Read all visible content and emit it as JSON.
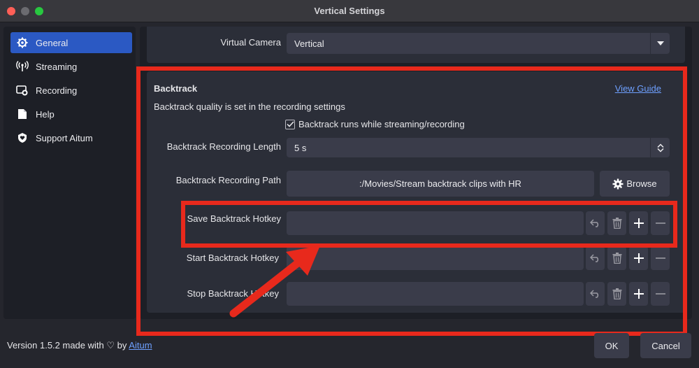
{
  "window": {
    "title": "Vertical Settings"
  },
  "sidebar": {
    "items": [
      {
        "label": "General",
        "icon": "gear-icon",
        "active": true
      },
      {
        "label": "Streaming",
        "icon": "antenna-icon"
      },
      {
        "label": "Recording",
        "icon": "record-icon"
      },
      {
        "label": "Help",
        "icon": "document-icon"
      },
      {
        "label": "Support Aitum",
        "icon": "heart-shield-icon"
      }
    ]
  },
  "general": {
    "virtual_camera_label": "Virtual Camera",
    "virtual_camera_value": "Vertical"
  },
  "backtrack": {
    "title": "Backtrack",
    "guide_link": "View Guide",
    "note": "Backtrack quality is set in the recording settings",
    "checkbox_label": "Backtrack runs while streaming/recording",
    "checkbox_checked": true,
    "length_label": "Backtrack Recording Length",
    "length_value": "5 s",
    "path_label": "Backtrack Recording Path",
    "path_value": ":/Movies/Stream backtrack clips with HR",
    "browse_label": "Browse",
    "hotkeys": [
      {
        "label": "Save Backtrack Hotkey",
        "value": ""
      },
      {
        "label": "Start Backtrack Hotkey",
        "value": ""
      },
      {
        "label": "Stop Backtrack Hotkey",
        "value": ""
      }
    ]
  },
  "footer": {
    "version_text": "Version 1.5.2 made with",
    "heart": "♡",
    "by_text": "by",
    "link": "Aitum",
    "ok_label": "OK",
    "cancel_label": "Cancel"
  },
  "colors": {
    "accent": "#2b59c3",
    "annotation": "#e8291c",
    "link": "#6ea0ff"
  }
}
